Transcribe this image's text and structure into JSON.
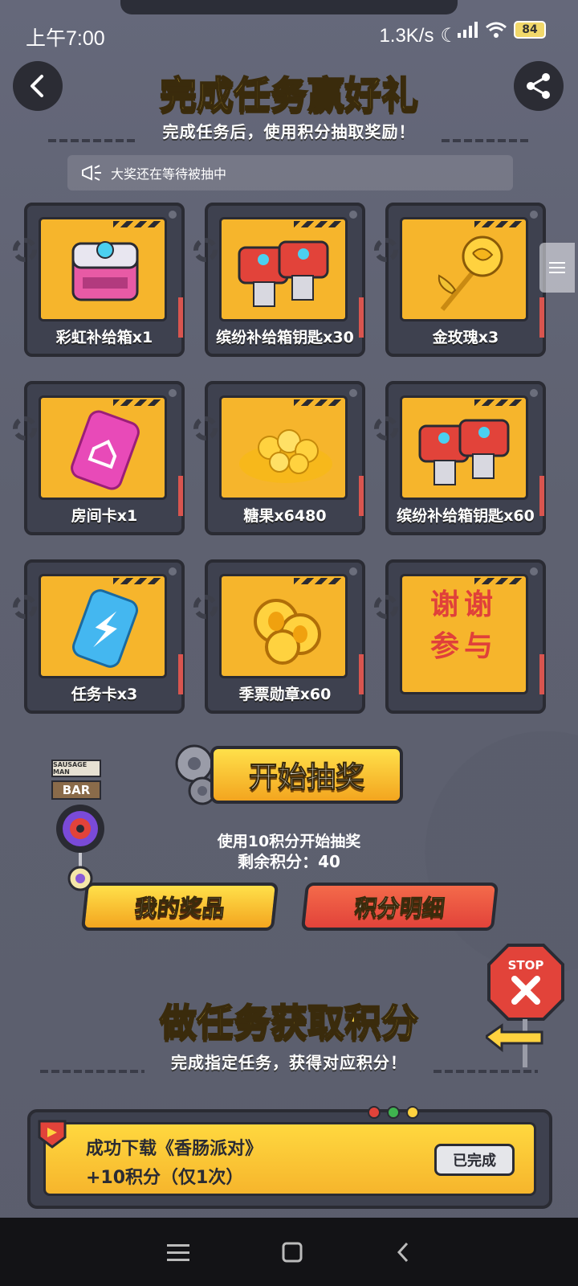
{
  "status_bar": {
    "time": "上午7:00",
    "net_speed": "1.3K/s",
    "battery": "84"
  },
  "header": {
    "title": "完成任务赢好礼",
    "subtitle": "完成任务后，使用积分抽取奖励！",
    "notice": "大奖还在等待被抽中"
  },
  "prizes": [
    {
      "label": "彩虹补给箱x1",
      "icon": "rainbow-supply-box"
    },
    {
      "label": "缤纷补给箱钥匙x30",
      "icon": "supply-box-key"
    },
    {
      "label": "金玫瑰x3",
      "icon": "golden-rose"
    },
    {
      "label": "房间卡x1",
      "icon": "room-card"
    },
    {
      "label": "糖果x6480",
      "icon": "candy-pile"
    },
    {
      "label": "缤纷补给箱钥匙x60",
      "icon": "supply-box-key"
    },
    {
      "label": "任务卡x3",
      "icon": "task-card"
    },
    {
      "label": "季票勋章x60",
      "icon": "season-medal"
    },
    {
      "label": "谢谢参与",
      "icon": "thanks"
    }
  ],
  "draw": {
    "button_label": "开始抽奖",
    "cost_text": "使用10积分开始抽奖",
    "remaining_text": "剩余积分：40"
  },
  "buttons": {
    "my_prizes": "我的奖品",
    "points_detail": "积分明细"
  },
  "deco": {
    "bar_top": "SAUSAGE MAN",
    "bar_label": "BAR",
    "stop": "STOP"
  },
  "tasks_section": {
    "title": "做任务获取积分",
    "subtitle": "完成指定任务，获得对应积分！"
  },
  "tasks": [
    {
      "line1": "成功下载《香肠派对》",
      "line2": "+10积分（仅1次）",
      "status": "已完成"
    }
  ],
  "colors": {
    "background": "#5e6170",
    "accent_yellow": "#f6b52c",
    "title_yellow": "#ffd84a",
    "points_red": "#e8493f"
  }
}
